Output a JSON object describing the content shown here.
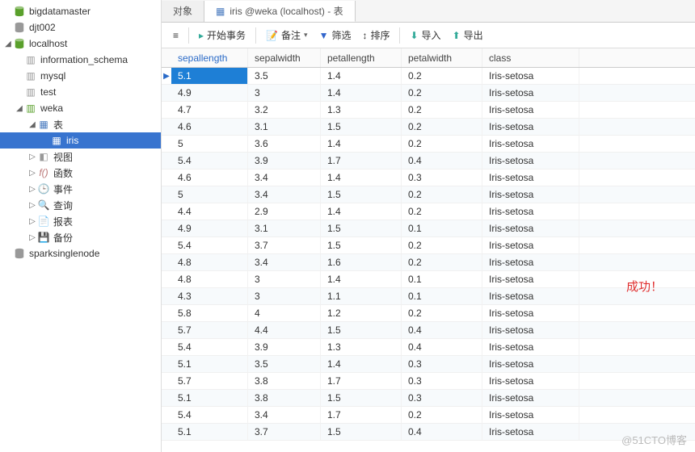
{
  "sidebar": {
    "conn1": "bigdatamaster",
    "conn2": "djt002",
    "conn3": "localhost",
    "db1": "information_schema",
    "db2": "mysql",
    "db3": "test",
    "db4": "weka",
    "folders": {
      "tables": "表",
      "views": "视图",
      "functions": "函数",
      "events": "事件",
      "queries": "查询",
      "reports": "报表",
      "backup": "备份"
    },
    "table1": "iris",
    "conn4": "sparksinglenode"
  },
  "tabs": {
    "objects": "对象",
    "active": "iris @weka (localhost) - 表"
  },
  "toolbar": {
    "start_tx": "开始事务",
    "memo": "备注",
    "filter": "筛选",
    "sort": "排序",
    "import": "导入",
    "export": "导出"
  },
  "grid": {
    "columns": [
      "sepallength",
      "sepalwidth",
      "petallength",
      "petalwidth",
      "class"
    ],
    "rows": [
      [
        "5.1",
        "3.5",
        "1.4",
        "0.2",
        "Iris-setosa"
      ],
      [
        "4.9",
        "3",
        "1.4",
        "0.2",
        "Iris-setosa"
      ],
      [
        "4.7",
        "3.2",
        "1.3",
        "0.2",
        "Iris-setosa"
      ],
      [
        "4.6",
        "3.1",
        "1.5",
        "0.2",
        "Iris-setosa"
      ],
      [
        "5",
        "3.6",
        "1.4",
        "0.2",
        "Iris-setosa"
      ],
      [
        "5.4",
        "3.9",
        "1.7",
        "0.4",
        "Iris-setosa"
      ],
      [
        "4.6",
        "3.4",
        "1.4",
        "0.3",
        "Iris-setosa"
      ],
      [
        "5",
        "3.4",
        "1.5",
        "0.2",
        "Iris-setosa"
      ],
      [
        "4.4",
        "2.9",
        "1.4",
        "0.2",
        "Iris-setosa"
      ],
      [
        "4.9",
        "3.1",
        "1.5",
        "0.1",
        "Iris-setosa"
      ],
      [
        "5.4",
        "3.7",
        "1.5",
        "0.2",
        "Iris-setosa"
      ],
      [
        "4.8",
        "3.4",
        "1.6",
        "0.2",
        "Iris-setosa"
      ],
      [
        "4.8",
        "3",
        "1.4",
        "0.1",
        "Iris-setosa"
      ],
      [
        "4.3",
        "3",
        "1.1",
        "0.1",
        "Iris-setosa"
      ],
      [
        "5.8",
        "4",
        "1.2",
        "0.2",
        "Iris-setosa"
      ],
      [
        "5.7",
        "4.4",
        "1.5",
        "0.4",
        "Iris-setosa"
      ],
      [
        "5.4",
        "3.9",
        "1.3",
        "0.4",
        "Iris-setosa"
      ],
      [
        "5.1",
        "3.5",
        "1.4",
        "0.3",
        "Iris-setosa"
      ],
      [
        "5.7",
        "3.8",
        "1.7",
        "0.3",
        "Iris-setosa"
      ],
      [
        "5.1",
        "3.8",
        "1.5",
        "0.3",
        "Iris-setosa"
      ],
      [
        "5.4",
        "3.4",
        "1.7",
        "0.2",
        "Iris-setosa"
      ],
      [
        "5.1",
        "3.7",
        "1.5",
        "0.4",
        "Iris-setosa"
      ]
    ]
  },
  "annotations": {
    "success": "成功！",
    "watermark": "@51CTO博客"
  }
}
